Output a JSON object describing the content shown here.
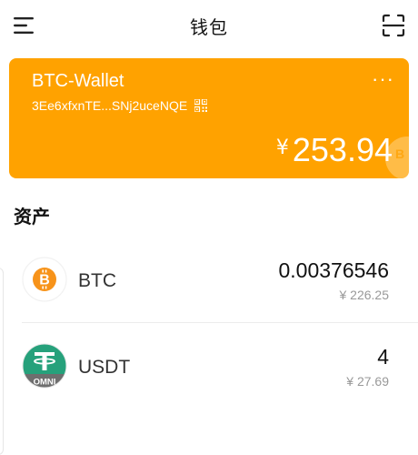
{
  "header": {
    "title": "钱包"
  },
  "wallet": {
    "name": "BTC-Wallet",
    "address": "3Ee6xfxnTE...SNj2uceNQE",
    "currency_symbol": "¥",
    "balance": "253.94",
    "more_label": "···",
    "watermark_letter": "B",
    "accent_color": "#ffa200"
  },
  "assets": {
    "title": "资产",
    "items": [
      {
        "symbol": "BTC",
        "amount": "0.00376546",
        "fiat_value": "¥ 226.25",
        "icon": "bitcoin-icon",
        "icon_color": "#f7931a"
      },
      {
        "symbol": "USDT",
        "amount": "4",
        "fiat_value": "¥ 27.69",
        "icon": "tether-omni-icon",
        "icon_color": "#26a17b",
        "icon_badge": "OMNI"
      }
    ]
  }
}
